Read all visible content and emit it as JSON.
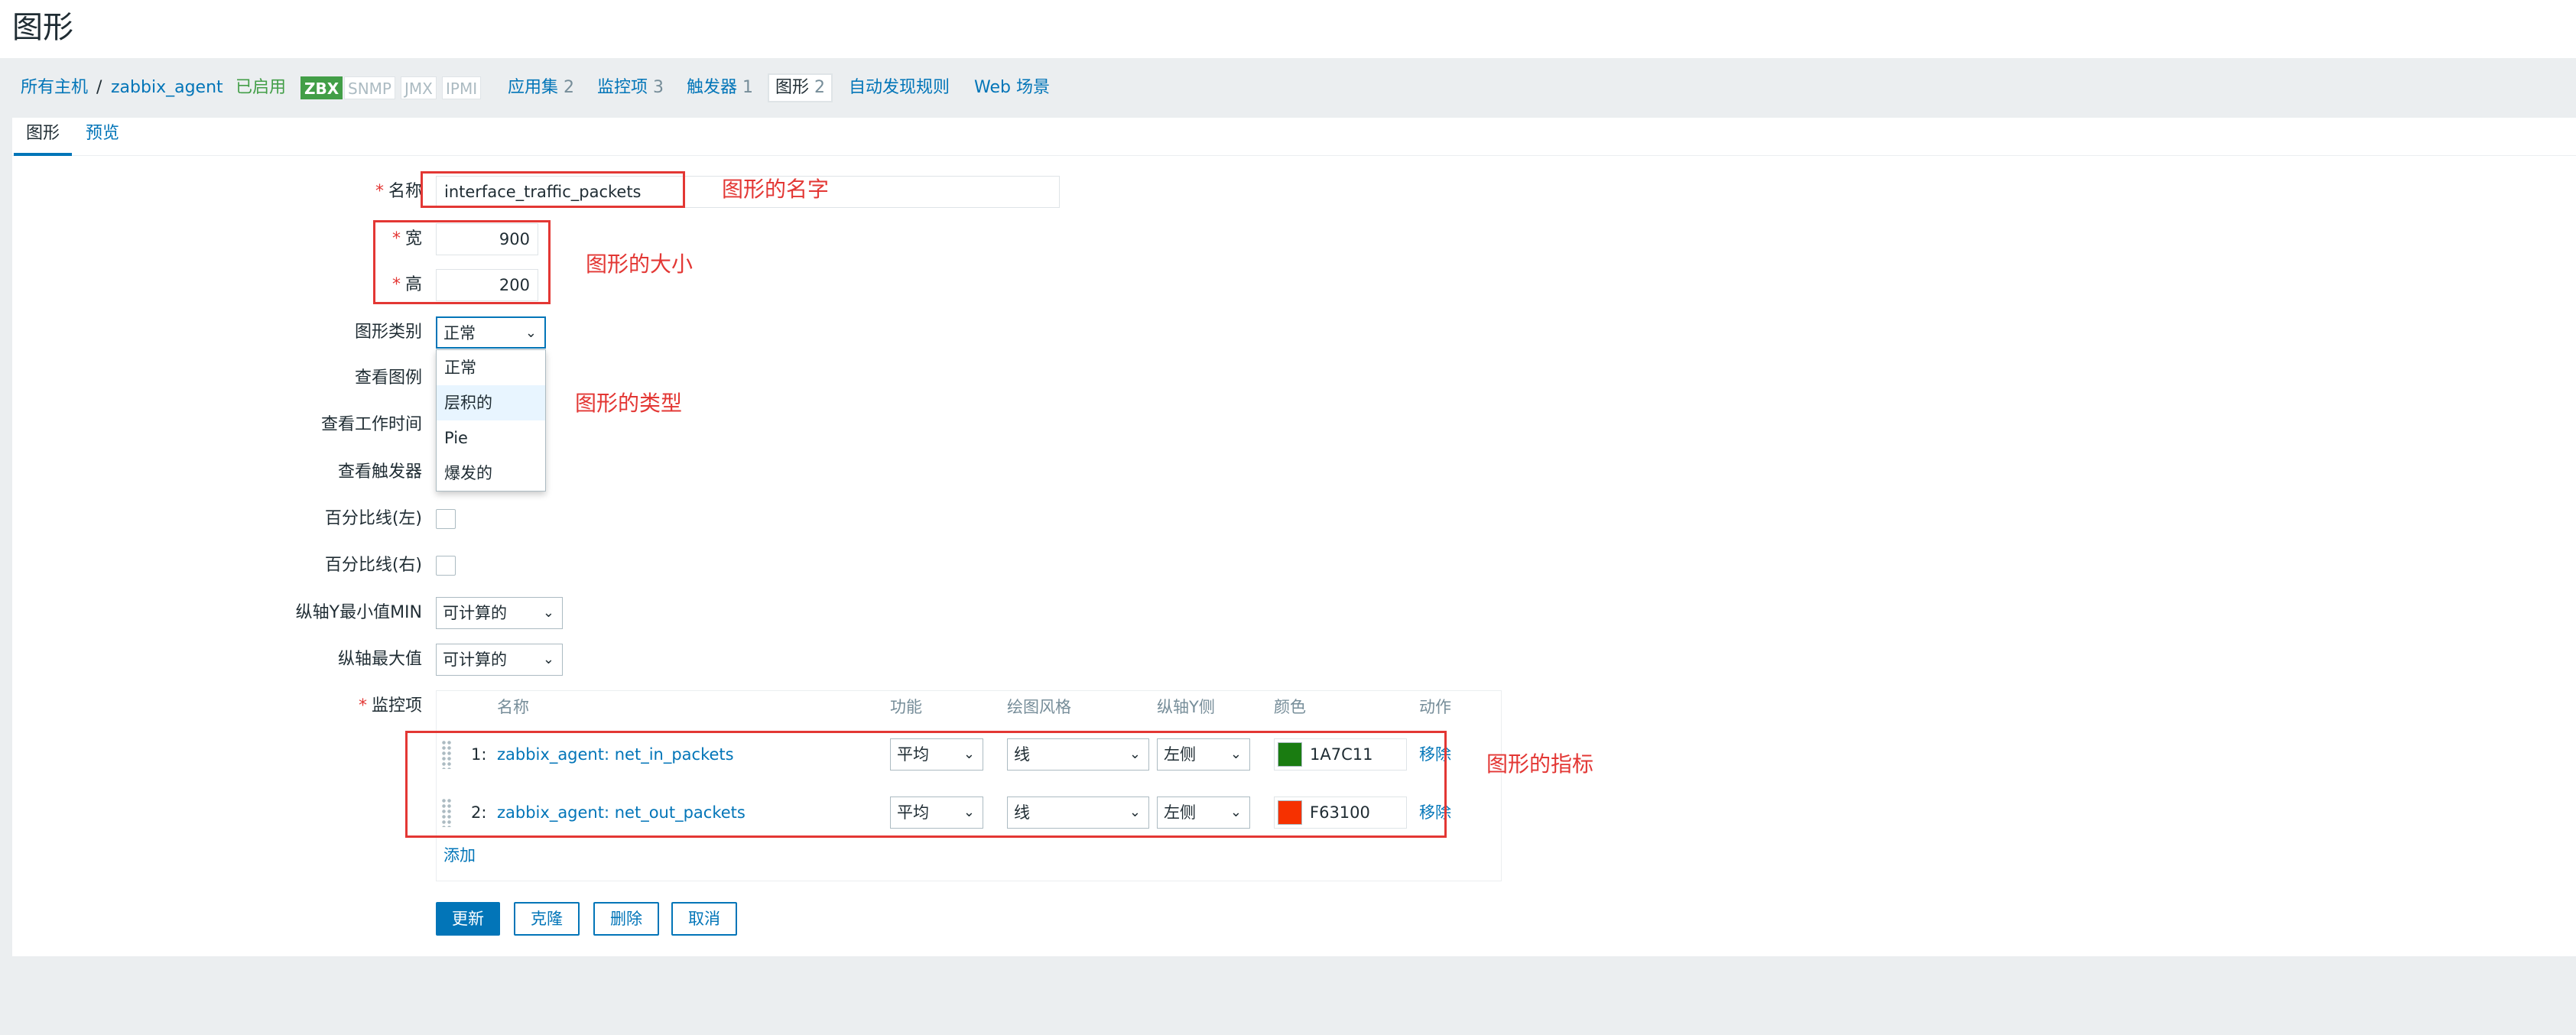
{
  "page": {
    "title": "图形"
  },
  "breadcrumb": {
    "all_hosts": "所有主机",
    "separator": "/",
    "host": "zabbix_agent",
    "status": "已启用",
    "badges": [
      "ZBX",
      "SNMP",
      "JMX",
      "IPMI"
    ],
    "app_label": "应用集",
    "app_count": "2",
    "items_label": "监控项",
    "items_count": "3",
    "triggers_label": "触发器",
    "triggers_count": "1",
    "graphs_label": "图形",
    "graphs_count": "2",
    "discovery": "自动发现规则",
    "web": "Web 场景"
  },
  "tabs": [
    {
      "label": "图形",
      "active": true
    },
    {
      "label": "预览",
      "active": false
    }
  ],
  "form": {
    "required_mark": "*",
    "name_label": "名称",
    "name_value": "interface_traffic_packets",
    "width_label": "宽",
    "width_value": "900",
    "height_label": "高",
    "height_value": "200",
    "graph_type_label": "图形类别",
    "graph_type_value": "正常",
    "graph_type_options": [
      "正常",
      "层积的",
      "Pie",
      "爆发的"
    ],
    "show_legend_label": "查看图例",
    "show_working_time_label": "查看工作时间",
    "show_triggers_label": "查看触发器",
    "percentile_left_label": "百分比线(左)",
    "percentile_right_label": "百分比线(右)",
    "ymin_label": "纵轴Y最小值MIN",
    "ymin_value": "可计算的",
    "ymax_label": "纵轴最大值",
    "ymax_value": "可计算的",
    "items_label": "监控项"
  },
  "items_table": {
    "headers": {
      "name": "名称",
      "function": "功能",
      "draw_style": "绘图风格",
      "y_axis_side": "纵轴Y侧",
      "color": "颜色",
      "action": "动作"
    },
    "rows": [
      {
        "num": "1:",
        "name": "zabbix_agent: net_in_packets",
        "function": "平均",
        "draw_style": "线",
        "y_axis_side": "左侧",
        "color": "1A7C11",
        "color_hex": "#1A7C11",
        "action": "移除"
      },
      {
        "num": "2:",
        "name": "zabbix_agent: net_out_packets",
        "function": "平均",
        "draw_style": "线",
        "y_axis_side": "左侧",
        "color": "F63100",
        "color_hex": "#F63100",
        "action": "移除"
      }
    ],
    "add": "添加"
  },
  "buttons": {
    "update": "更新",
    "clone": "克隆",
    "delete": "删除",
    "cancel": "取消"
  },
  "annotations": {
    "name": "图形的名字",
    "size": "图形的大小",
    "type": "图形的类型",
    "items": "图形的指标"
  },
  "colors": {
    "link": "#0275b8",
    "annotation": "#e33734",
    "enabled": "#429e47"
  }
}
